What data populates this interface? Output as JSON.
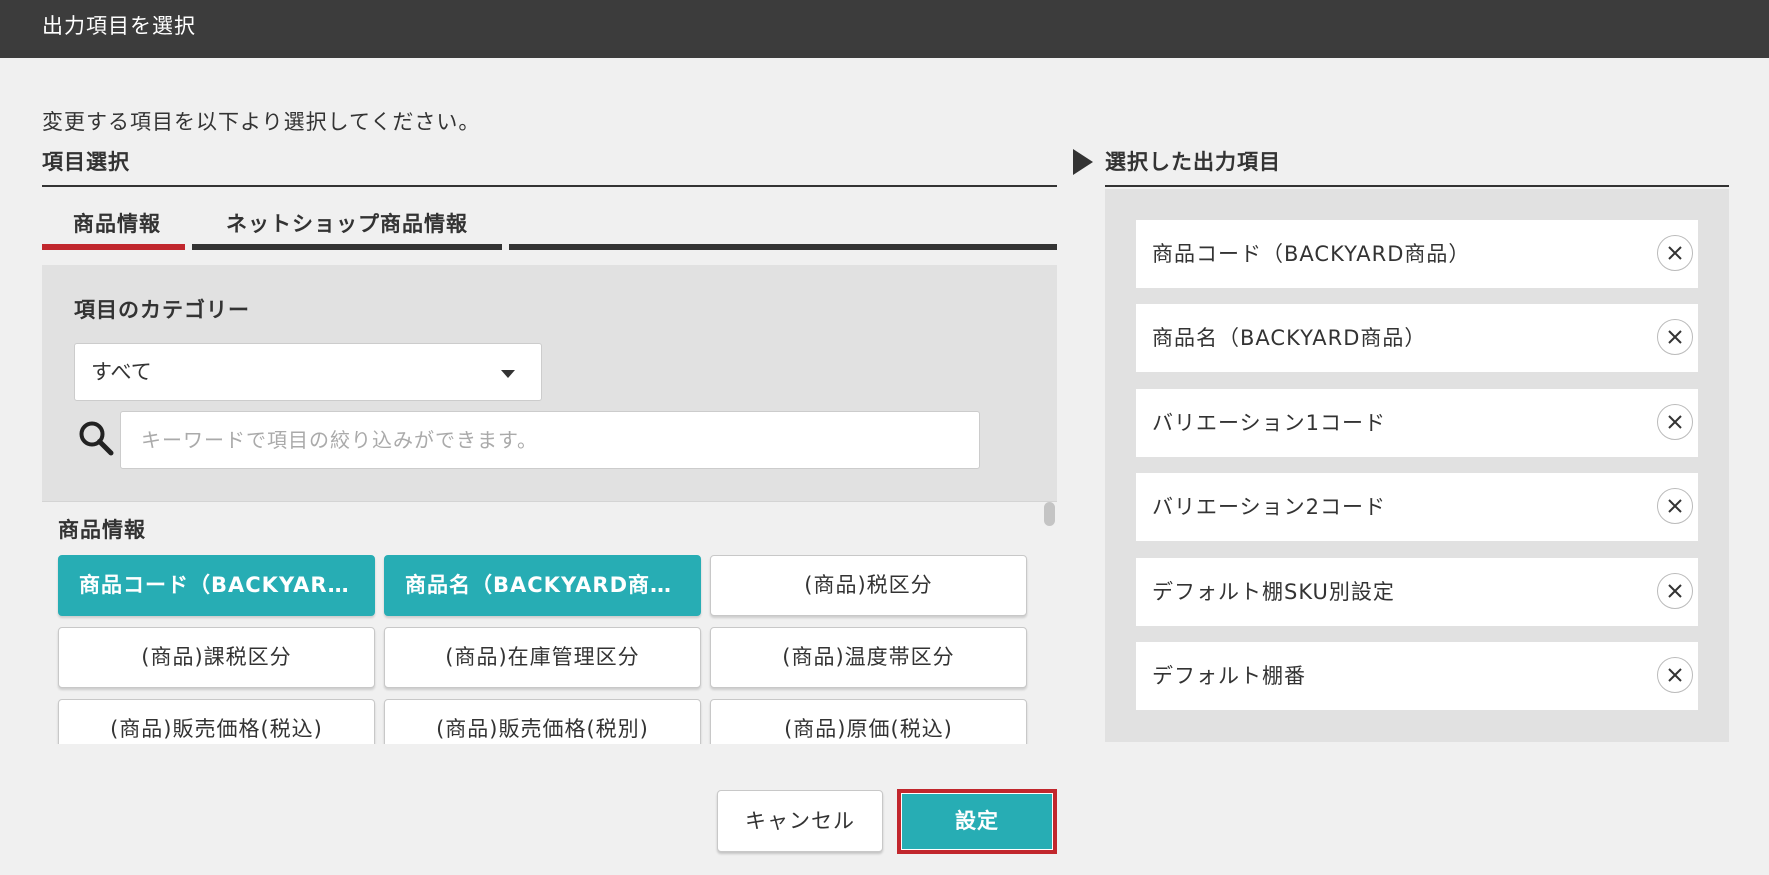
{
  "dialog": {
    "title": "出力項目を選択",
    "instruction": "変更する項目を以下より選択してください。"
  },
  "left": {
    "section_title": "項目選択",
    "tabs": [
      {
        "label": "商品情報",
        "active": true
      },
      {
        "label": "ネットショップ商品情報",
        "active": false
      }
    ],
    "category_label": "項目のカテゴリー",
    "category_value": "すべて",
    "search_placeholder": "キーワードで項目の絞り込みができます。",
    "group_label": "商品情報",
    "items": [
      {
        "label": "商品コード（BACKYARD商品）",
        "selected": true
      },
      {
        "label": "商品名（BACKYARD商品）",
        "selected": true
      },
      {
        "label": "(商品)税区分",
        "selected": false
      },
      {
        "label": "(商品)課税区分",
        "selected": false
      },
      {
        "label": "(商品)在庫管理区分",
        "selected": false
      },
      {
        "label": "(商品)温度帯区分",
        "selected": false
      },
      {
        "label": "(商品)販売価格(税込)",
        "selected": false
      },
      {
        "label": "(商品)販売価格(税別)",
        "selected": false
      },
      {
        "label": "(商品)原価(税込)",
        "selected": false
      }
    ]
  },
  "right": {
    "section_title": "選択した出力項目",
    "selected": [
      {
        "label": "商品コード（BACKYARD商品）"
      },
      {
        "label": "商品名（BACKYARD商品）"
      },
      {
        "label": "バリエーション1コード"
      },
      {
        "label": "バリエーション2コード"
      },
      {
        "label": "デフォルト棚SKU別設定"
      },
      {
        "label": "デフォルト棚番"
      }
    ]
  },
  "footer": {
    "cancel_label": "キャンセル",
    "ok_label": "設定"
  },
  "colors": {
    "accent": "#27adb4",
    "active_tab": "#c1272d",
    "titlebar": "#3c3c3c"
  }
}
